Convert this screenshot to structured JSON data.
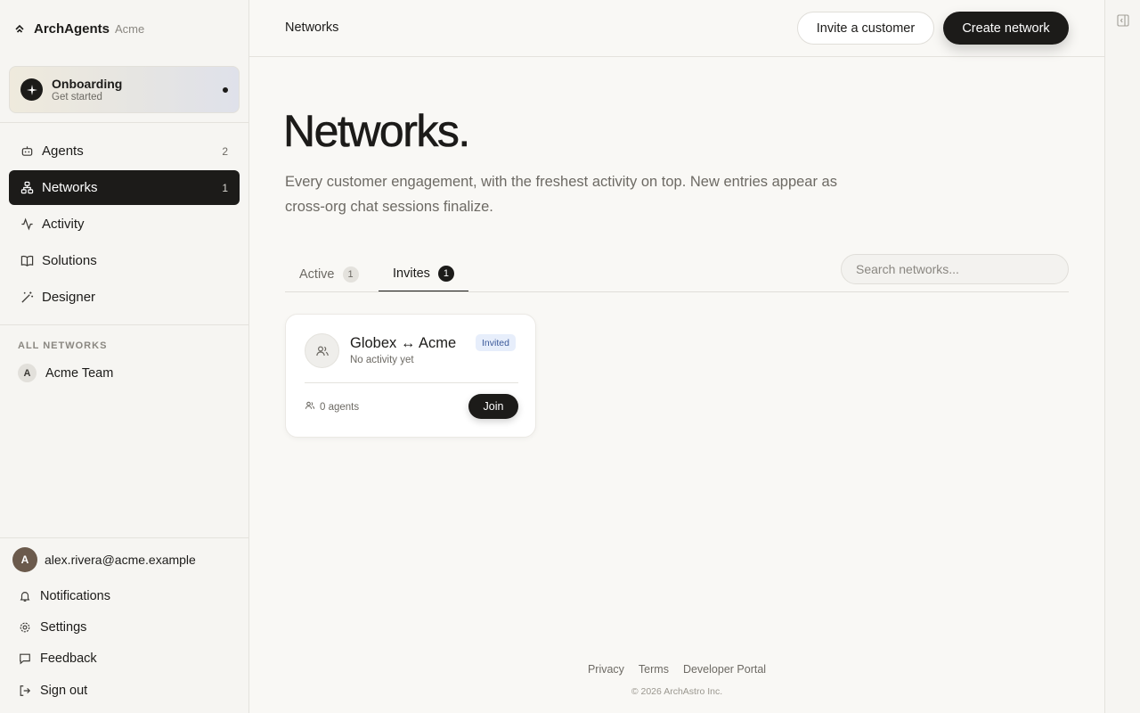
{
  "brand": {
    "name": "ArchAgents",
    "org": "Acme"
  },
  "onboarding": {
    "title": "Onboarding",
    "subtitle": "Get started"
  },
  "sidebar": {
    "items": [
      {
        "label": "Agents",
        "count": "2",
        "icon": "robot-icon"
      },
      {
        "label": "Networks",
        "count": "1",
        "icon": "network-icon",
        "active": true
      },
      {
        "label": "Activity",
        "count": "",
        "icon": "activity-icon"
      },
      {
        "label": "Solutions",
        "count": "",
        "icon": "book-icon"
      },
      {
        "label": "Designer",
        "count": "",
        "icon": "wand-icon"
      }
    ],
    "section_label": "ALL NETWORKS",
    "team": {
      "initial": "A",
      "name": "Acme Team"
    }
  },
  "user": {
    "initial": "A",
    "email": "alex.rivera@acme.example"
  },
  "footer_nav": [
    {
      "label": "Notifications",
      "icon": "bell-icon"
    },
    {
      "label": "Settings",
      "icon": "gear-icon"
    },
    {
      "label": "Feedback",
      "icon": "message-icon"
    },
    {
      "label": "Sign out",
      "icon": "sign-out-icon"
    }
  ],
  "topbar": {
    "breadcrumb": "Networks",
    "invite_label": "Invite a customer",
    "create_label": "Create network"
  },
  "hero": {
    "title": "Networks.",
    "subtitle": "Every customer engagement, with the freshest activity on top. New entries appear as cross-org chat sessions finalize."
  },
  "tabs": [
    {
      "label": "Active",
      "count": "1"
    },
    {
      "label": "Invites",
      "count": "1",
      "active": true
    }
  ],
  "search": {
    "placeholder": "Search networks..."
  },
  "card": {
    "title": "Globex ↔ Acme",
    "subtitle": "No activity yet",
    "badge": "Invited",
    "agents": "0 agents",
    "join_label": "Join"
  },
  "footer": {
    "links": [
      "Privacy",
      "Terms",
      "Developer Portal"
    ],
    "copyright": "© 2026 ArchAstro Inc."
  },
  "colors": {
    "accent": "#1c1b19",
    "badge_bg": "#e7eefb",
    "badge_text": "#3c5a9a"
  }
}
